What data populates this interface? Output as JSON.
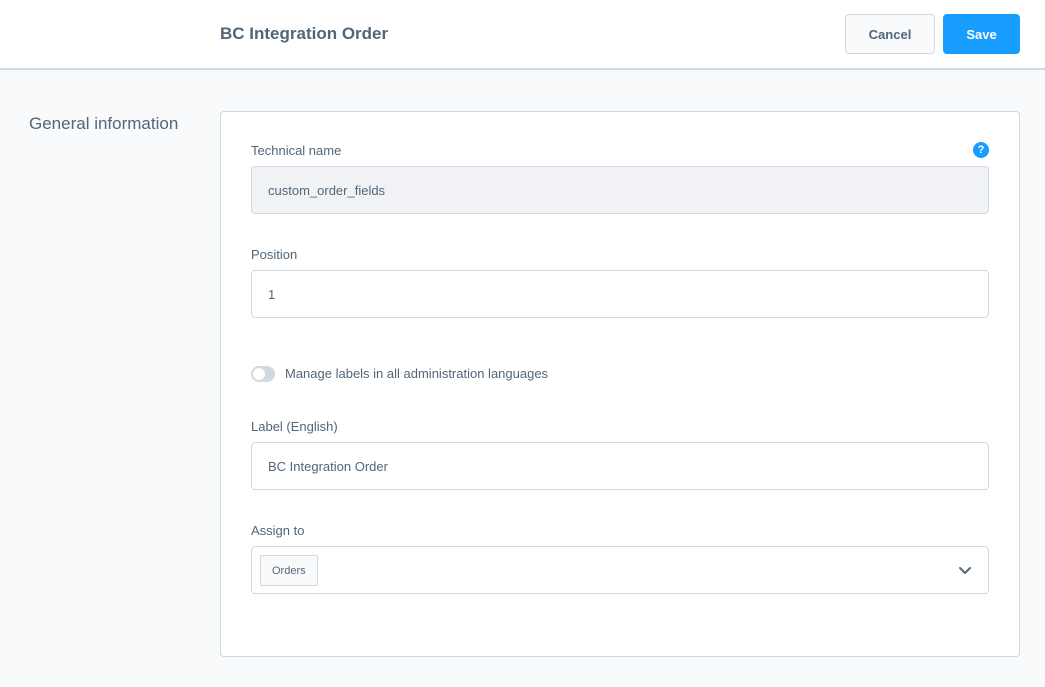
{
  "header": {
    "title": "BC Integration Order",
    "cancel_label": "Cancel",
    "save_label": "Save"
  },
  "section": {
    "title": "General information"
  },
  "form": {
    "technical_name": {
      "label": "Technical name",
      "value": "custom_order_fields",
      "help_icon": "question-circle-icon"
    },
    "position": {
      "label": "Position",
      "value": "1"
    },
    "manage_labels_toggle": {
      "label": "Manage labels in all administration languages",
      "enabled": false
    },
    "label_english": {
      "label": "Label (English)",
      "value": "BC Integration Order"
    },
    "assign_to": {
      "label": "Assign to",
      "selected": "Orders"
    }
  },
  "colors": {
    "primary": "#189eff",
    "text": "#52667a",
    "border": "#d1d9e0",
    "background": "#f9fafb"
  }
}
